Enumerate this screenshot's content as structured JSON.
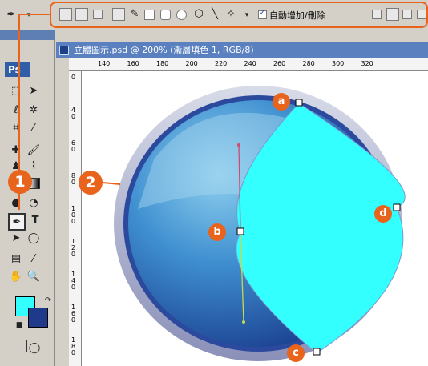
{
  "options_bar": {
    "auto_add_delete_label": "自動增加/刪除"
  },
  "toolbox": {
    "logo": "Ps",
    "type_tool_label": "T"
  },
  "document": {
    "title": "立體圖示.psd @ 200% (漸層填色 1, RGB/8)",
    "ruler_top_labels": [
      "140",
      "160",
      "180",
      "200",
      "220",
      "240",
      "260",
      "280",
      "300",
      "320"
    ],
    "ruler_left_labels": [
      "0",
      "4 0",
      "6 0",
      "8 0",
      "1 0 0",
      "1 2 0",
      "1 4 0",
      "1 6 0",
      "1 8 0"
    ]
  },
  "callouts": {
    "one": "1",
    "two": "2",
    "a": "a",
    "b": "b",
    "c": "c",
    "d": "d"
  },
  "colors": {
    "accent_orange": "#e8631c",
    "foreground_color": "#33ffff",
    "background_color": "#1f3a8a",
    "fill_cyan": "#33ffff"
  },
  "icons": [
    "pen-tool-icon",
    "freeform-pen-icon",
    "rectangle-shape-icon",
    "rounded-rect-icon",
    "ellipse-icon",
    "polygon-icon",
    "line-icon",
    "custom-shape-icon",
    "marquee-icon",
    "move-icon",
    "lasso-icon",
    "magic-wand-icon",
    "crop-icon",
    "slice-icon",
    "healing-brush-icon",
    "brush-icon",
    "clone-stamp-icon",
    "history-brush-icon",
    "eraser-icon",
    "gradient-icon",
    "blur-icon",
    "dodge-icon",
    "type-icon",
    "path-selection-icon",
    "ellipse-tool-icon",
    "notes-icon",
    "eyedropper-icon",
    "hand-icon",
    "zoom-icon",
    "quick-mask-icon"
  ]
}
